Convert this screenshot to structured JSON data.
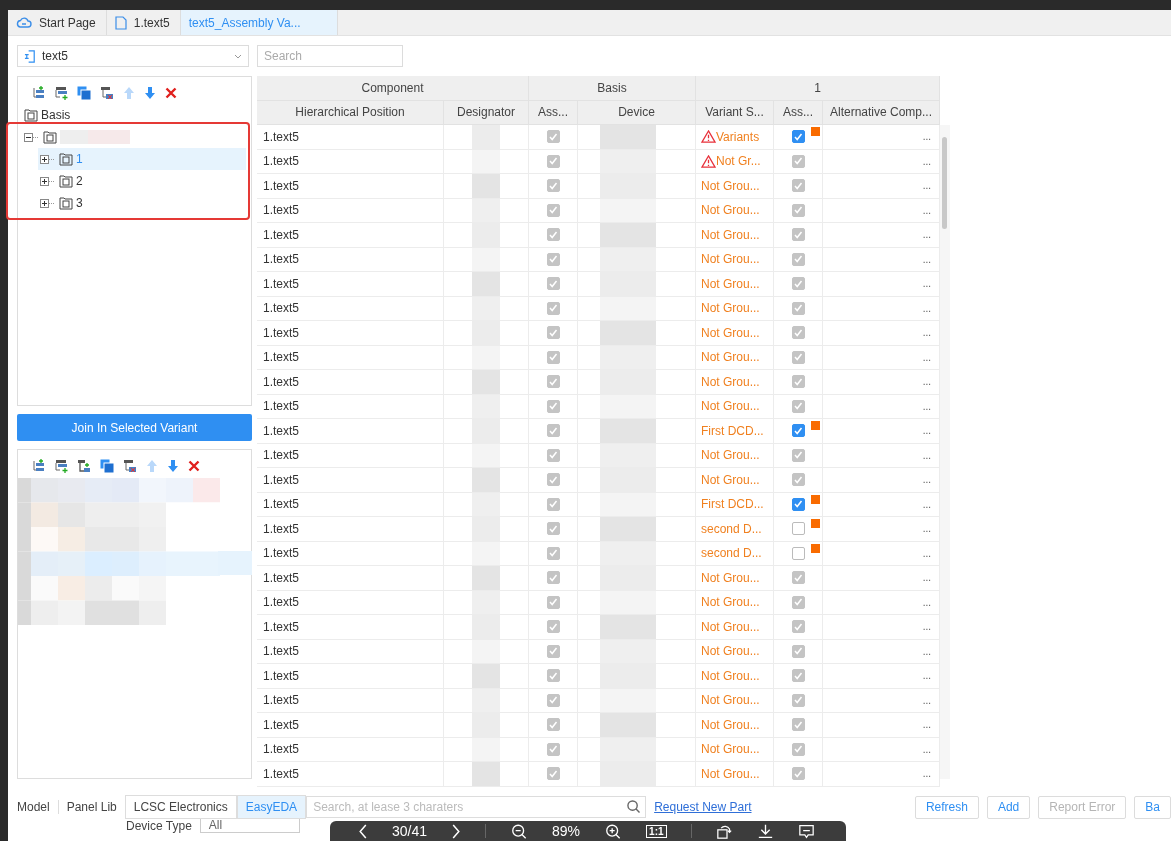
{
  "tabs": [
    {
      "label": "Start Page",
      "kind": "cloud",
      "selected": false
    },
    {
      "label": "1.text5",
      "kind": "file",
      "selected": false
    },
    {
      "label": "text5_Assembly Va...",
      "kind": "none",
      "selected": true
    }
  ],
  "project": {
    "value": "text5"
  },
  "search": {
    "placeholder": "Search"
  },
  "tree": {
    "root_label": "Basis",
    "nodes": [
      {
        "label": "1",
        "selected": true
      },
      {
        "label": "2",
        "selected": false
      },
      {
        "label": "3",
        "selected": false
      }
    ]
  },
  "join_button": "Join In Selected Variant",
  "table": {
    "groups": [
      {
        "label": "Component",
        "columns": [
          "Hierarchical Position",
          "Designator"
        ]
      },
      {
        "label": "Basis",
        "columns": [
          "Ass...",
          "Device"
        ]
      },
      {
        "label": "1",
        "columns": [
          "Variant S...",
          "Ass...",
          "Alternative Comp..."
        ]
      }
    ],
    "rows": [
      {
        "position": "1.text5",
        "basis_checked": true,
        "status": "Variants",
        "warning": true,
        "checked": true,
        "disabled": false,
        "flag": true,
        "alternative": "..."
      },
      {
        "position": "1.text5",
        "basis_checked": true,
        "status": "Not Gr...",
        "warning": true,
        "checked": true,
        "disabled": true,
        "flag": false,
        "alternative": "..."
      },
      {
        "position": "1.text5",
        "basis_checked": true,
        "status": "Not Grou...",
        "warning": false,
        "checked": true,
        "disabled": true,
        "flag": false,
        "alternative": "..."
      },
      {
        "position": "1.text5",
        "basis_checked": true,
        "status": "Not Grou...",
        "warning": false,
        "checked": true,
        "disabled": true,
        "flag": false,
        "alternative": "..."
      },
      {
        "position": "1.text5",
        "basis_checked": true,
        "status": "Not Grou...",
        "warning": false,
        "checked": true,
        "disabled": true,
        "flag": false,
        "alternative": "..."
      },
      {
        "position": "1.text5",
        "basis_checked": true,
        "status": "Not Grou...",
        "warning": false,
        "checked": true,
        "disabled": true,
        "flag": false,
        "alternative": "..."
      },
      {
        "position": "1.text5",
        "basis_checked": true,
        "status": "Not Grou...",
        "warning": false,
        "checked": true,
        "disabled": true,
        "flag": false,
        "alternative": "..."
      },
      {
        "position": "1.text5",
        "basis_checked": true,
        "status": "Not Grou...",
        "warning": false,
        "checked": true,
        "disabled": true,
        "flag": false,
        "alternative": "..."
      },
      {
        "position": "1.text5",
        "basis_checked": true,
        "status": "Not Grou...",
        "warning": false,
        "checked": true,
        "disabled": true,
        "flag": false,
        "alternative": "..."
      },
      {
        "position": "1.text5",
        "basis_checked": true,
        "status": "Not Grou...",
        "warning": false,
        "checked": true,
        "disabled": true,
        "flag": false,
        "alternative": "..."
      },
      {
        "position": "1.text5",
        "basis_checked": true,
        "status": "Not Grou...",
        "warning": false,
        "checked": true,
        "disabled": true,
        "flag": false,
        "alternative": "..."
      },
      {
        "position": "1.text5",
        "basis_checked": true,
        "status": "Not Grou...",
        "warning": false,
        "checked": true,
        "disabled": true,
        "flag": false,
        "alternative": "..."
      },
      {
        "position": "1.text5",
        "basis_checked": true,
        "status": "First DCD...",
        "warning": false,
        "checked": true,
        "disabled": false,
        "flag": true,
        "alternative": "..."
      },
      {
        "position": "1.text5",
        "basis_checked": true,
        "status": "Not Grou...",
        "warning": false,
        "checked": true,
        "disabled": true,
        "flag": false,
        "alternative": "..."
      },
      {
        "position": "1.text5",
        "basis_checked": true,
        "status": "Not Grou...",
        "warning": false,
        "checked": true,
        "disabled": true,
        "flag": false,
        "alternative": "..."
      },
      {
        "position": "1.text5",
        "basis_checked": true,
        "status": "First DCD...",
        "warning": false,
        "checked": true,
        "disabled": false,
        "flag": true,
        "alternative": "..."
      },
      {
        "position": "1.text5",
        "basis_checked": true,
        "status": "second D...",
        "warning": false,
        "checked": false,
        "disabled": false,
        "flag": true,
        "alternative": "..."
      },
      {
        "position": "1.text5",
        "basis_checked": true,
        "status": "second D...",
        "warning": false,
        "checked": false,
        "disabled": false,
        "flag": true,
        "alternative": "..."
      },
      {
        "position": "1.text5",
        "basis_checked": true,
        "status": "Not Grou...",
        "warning": false,
        "checked": true,
        "disabled": true,
        "flag": false,
        "alternative": "..."
      },
      {
        "position": "1.text5",
        "basis_checked": true,
        "status": "Not Grou...",
        "warning": false,
        "checked": true,
        "disabled": true,
        "flag": false,
        "alternative": "..."
      },
      {
        "position": "1.text5",
        "basis_checked": true,
        "status": "Not Grou...",
        "warning": false,
        "checked": true,
        "disabled": true,
        "flag": false,
        "alternative": "..."
      },
      {
        "position": "1.text5",
        "basis_checked": true,
        "status": "Not Grou...",
        "warning": false,
        "checked": true,
        "disabled": true,
        "flag": false,
        "alternative": "..."
      },
      {
        "position": "1.text5",
        "basis_checked": true,
        "status": "Not Grou...",
        "warning": false,
        "checked": true,
        "disabled": true,
        "flag": false,
        "alternative": "..."
      },
      {
        "position": "1.text5",
        "basis_checked": true,
        "status": "Not Grou...",
        "warning": false,
        "checked": true,
        "disabled": true,
        "flag": false,
        "alternative": "..."
      },
      {
        "position": "1.text5",
        "basis_checked": true,
        "status": "Not Grou...",
        "warning": false,
        "checked": true,
        "disabled": true,
        "flag": false,
        "alternative": "..."
      },
      {
        "position": "1.text5",
        "basis_checked": true,
        "status": "Not Grou...",
        "warning": false,
        "checked": true,
        "disabled": true,
        "flag": false,
        "alternative": "..."
      },
      {
        "position": "1.text5",
        "basis_checked": true,
        "status": "Not Grou...",
        "warning": false,
        "checked": true,
        "disabled": true,
        "flag": false,
        "alternative": "..."
      }
    ]
  },
  "library_tabs": [
    {
      "label": "Model",
      "selected": false
    },
    {
      "label": "Panel Lib",
      "selected": false
    },
    {
      "label": "LCSC Electronics",
      "selected": false
    },
    {
      "label": "EasyEDA",
      "selected": true
    }
  ],
  "library_search": {
    "placeholder": "Search, at lease 3 charaters"
  },
  "request_link": "Request New Part",
  "buttons": [
    {
      "label": "Refresh",
      "disabled": false
    },
    {
      "label": "Add",
      "disabled": false
    },
    {
      "label": "Report Error",
      "disabled": true
    },
    {
      "label": "Ba",
      "disabled": false
    }
  ],
  "filter": {
    "label": "Device Type",
    "value": "All"
  },
  "viewer": {
    "page": "30/41",
    "zoom": "89%",
    "actual_size": "1:1"
  }
}
